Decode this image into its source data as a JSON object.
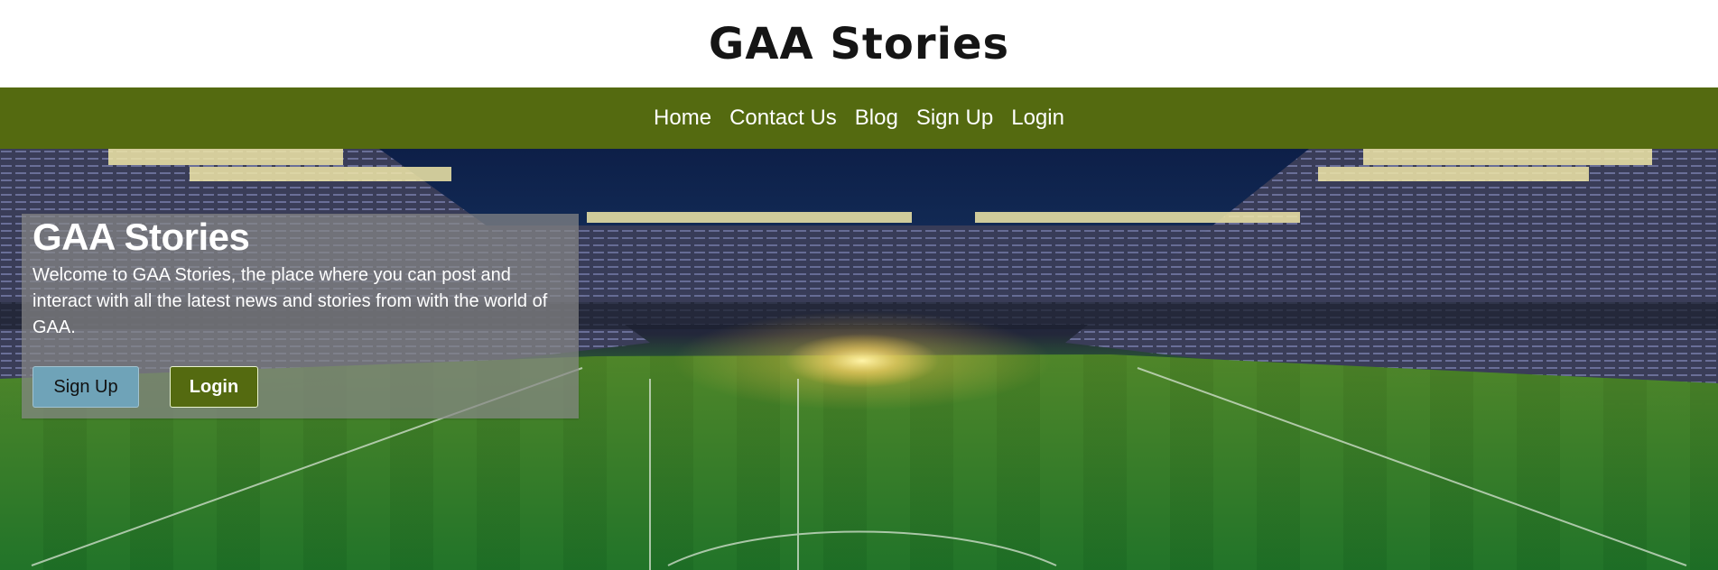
{
  "site": {
    "title": "GAA Stories"
  },
  "nav": {
    "items": [
      {
        "label": "Home"
      },
      {
        "label": "Contact Us"
      },
      {
        "label": "Blog"
      },
      {
        "label": "Sign Up"
      },
      {
        "label": "Login"
      }
    ]
  },
  "hero": {
    "title": "GAA Stories",
    "text": "Welcome to GAA Stories, the place where you can post and interact with all the latest news and stories from with the world of GAA.",
    "buttons": {
      "signup": "Sign Up",
      "login": "Login"
    },
    "image": {
      "subject": "stadium-photo"
    }
  },
  "colors": {
    "nav": "#546a10",
    "signup": "#6fa3b8",
    "login": "#546a10"
  }
}
